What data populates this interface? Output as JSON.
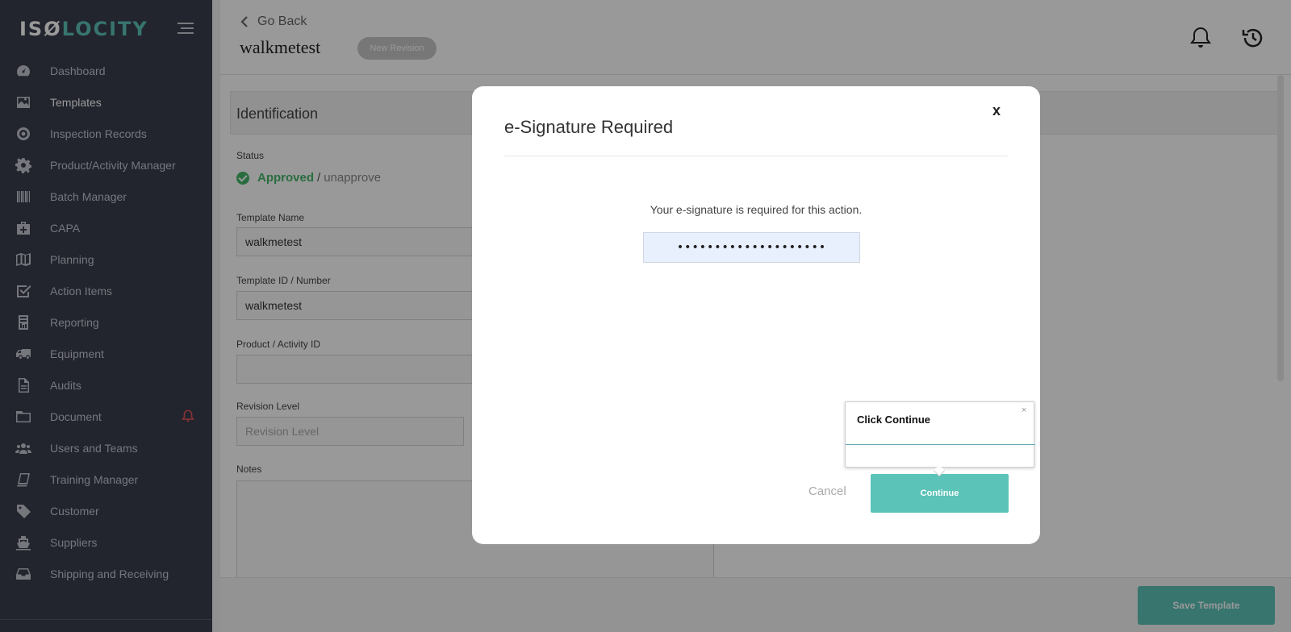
{
  "brand": {
    "logo_iso": "ISØ",
    "logo_locity": "LOCITY"
  },
  "sidebar": {
    "items": [
      {
        "label": "Dashboard",
        "icon": "dashboard-icon"
      },
      {
        "label": "Templates",
        "icon": "image-icon"
      },
      {
        "label": "Inspection Records",
        "icon": "target-icon"
      },
      {
        "label": "Product/Activity Manager",
        "icon": "gear-icon"
      },
      {
        "label": "Batch Manager",
        "icon": "barcode-icon"
      },
      {
        "label": "CAPA",
        "icon": "medkit-icon"
      },
      {
        "label": "Planning",
        "icon": "map-icon"
      },
      {
        "label": "Action Items",
        "icon": "checkbox-icon"
      },
      {
        "label": "Reporting",
        "icon": "report-icon"
      },
      {
        "label": "Equipment",
        "icon": "truck-icon"
      },
      {
        "label": "Audits",
        "icon": "file-icon"
      },
      {
        "label": "Document",
        "icon": "folder-icon"
      },
      {
        "label": "Users and Teams",
        "icon": "users-icon"
      },
      {
        "label": "Training Manager",
        "icon": "book-icon"
      },
      {
        "label": "Customer",
        "icon": "tag-icon"
      },
      {
        "label": "Suppliers",
        "icon": "ship-icon"
      },
      {
        "label": "Shipping and Receiving",
        "icon": "inbox-icon"
      }
    ],
    "active": "Templates"
  },
  "header": {
    "go_back": "Go Back",
    "title": "walkmetest",
    "revision_pill": "New Revision"
  },
  "identification": {
    "section_title": "Identification",
    "status_label": "Status",
    "status_approved": "Approved",
    "status_sep": "/",
    "status_unapprove": "unapprove",
    "template_name_label": "Template Name",
    "template_name_value": "walkmetest",
    "template_id_label": "Template ID / Number",
    "template_id_value": "walkmetest",
    "product_id_label": "Product / Activity ID",
    "product_id_value": "",
    "revision_level_label": "Revision Level",
    "revision_level_placeholder": "Revision Level",
    "notes_label": "Notes"
  },
  "footer": {
    "save_label": "Save Template"
  },
  "modal": {
    "title": "e-Signature Required",
    "close": "x",
    "message": "Your e-signature is required for this action.",
    "signature_value": "••••••••••••••••••••",
    "cancel_label": "Cancel",
    "continue_label": "Continue"
  },
  "tooltip": {
    "text": "Click Continue",
    "close": "×"
  },
  "colors": {
    "sidebar_bg": "#3a3d4d",
    "accent": "#5cc3b8",
    "approved": "#45b66a",
    "alert": "#e05656"
  }
}
